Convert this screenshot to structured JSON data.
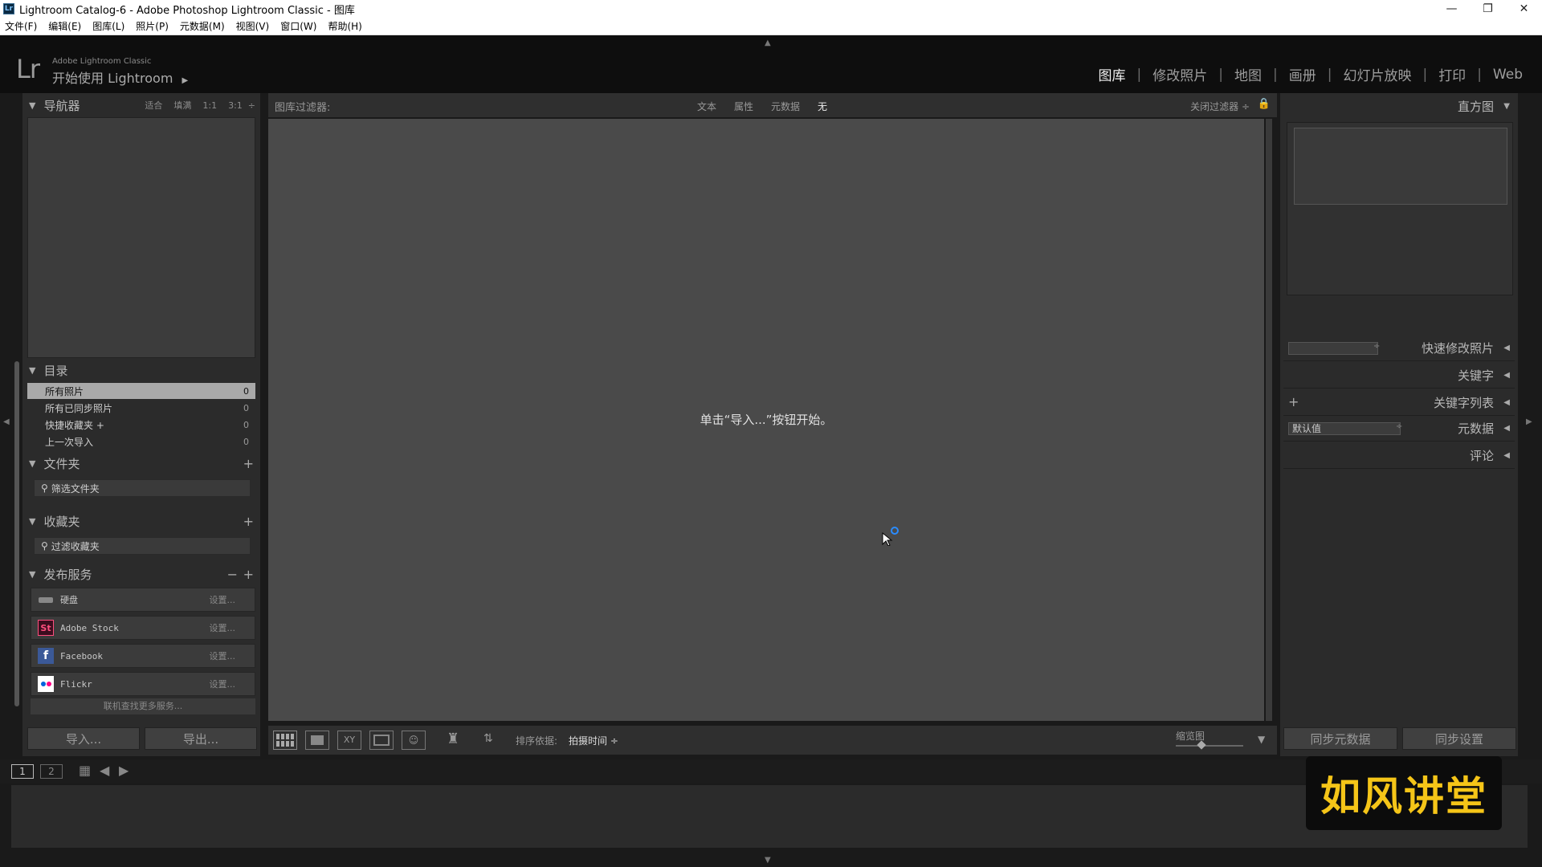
{
  "window": {
    "title": "Lightroom Catalog-6 - Adobe Photoshop Lightroom Classic - 图库",
    "app_icon": "Lr"
  },
  "menu": [
    "文件(F)",
    "编辑(E)",
    "图库(L)",
    "照片(P)",
    "元数据(M)",
    "视图(V)",
    "窗口(W)",
    "帮助(H)"
  ],
  "header": {
    "logo": "Lr",
    "brand_small": "Adobe Lightroom Classic",
    "brand_big": "开始使用 Lightroom"
  },
  "modules": [
    "图库",
    "修改照片",
    "地图",
    "画册",
    "幻灯片放映",
    "打印",
    "Web"
  ],
  "navigator": {
    "title": "导航器",
    "zoom_options": [
      "适合",
      "填满",
      "1:1",
      "3:1"
    ]
  },
  "catalog": {
    "title": "目录",
    "items": [
      {
        "label": "所有照片",
        "count": "0"
      },
      {
        "label": "所有已同步照片",
        "count": "0"
      },
      {
        "label": "快捷收藏夹 +",
        "count": "0"
      },
      {
        "label": "上一次导入",
        "count": "0"
      }
    ]
  },
  "folders": {
    "title": "文件夹",
    "search": "筛选文件夹"
  },
  "collections": {
    "title": "收藏夹",
    "search": "过滤收藏夹"
  },
  "publish": {
    "title": "发布服务",
    "items": [
      {
        "label": "硬盘",
        "settings": "设置..."
      },
      {
        "label": "Adobe Stock",
        "settings": "设置..."
      },
      {
        "label": "Facebook",
        "settings": "设置..."
      },
      {
        "label": "Flickr",
        "settings": "设置..."
      }
    ],
    "find_more": "联机查找更多服务..."
  },
  "buttons": {
    "import": "导入...",
    "export": "导出..."
  },
  "filter": {
    "label": "图库过滤器:",
    "tabs": [
      "文本",
      "属性",
      "元数据",
      "无"
    ],
    "close": "关闭过滤器 ÷"
  },
  "center": {
    "message": "单击“导入...”按钮开始。"
  },
  "toolbar": {
    "sort_label": "排序依据:",
    "sort_value": "拍摄时间 ÷",
    "thumb_label": "缩览图"
  },
  "right": {
    "histogram": "直方图",
    "quick_develop": "快速修改照片",
    "keywording": "关键字",
    "keyword_list": "关键字列表",
    "metadata": "元数据",
    "metadata_preset": "默认值",
    "comments": "评论",
    "sync_metadata": "同步元数据",
    "sync_settings": "同步设置"
  },
  "filmstrip": {
    "view1": "1",
    "view2": "2"
  },
  "watermark": "如风讲堂"
}
